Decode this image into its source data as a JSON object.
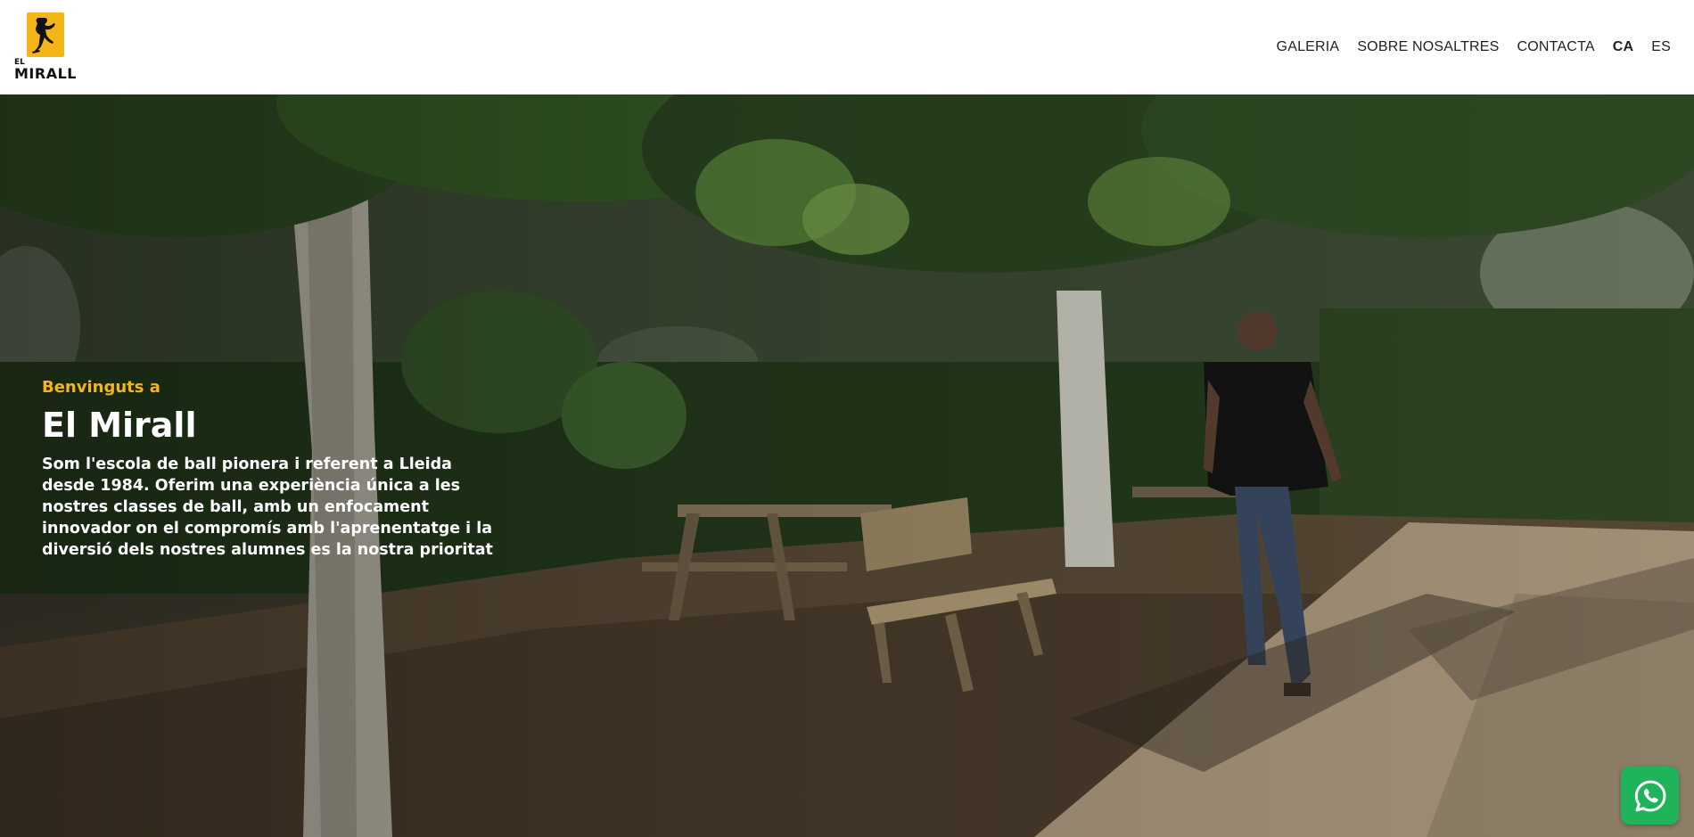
{
  "logo": {
    "line1": "EL",
    "line2": "MIRALL",
    "brand_color": "#f3b518"
  },
  "nav": {
    "items": [
      {
        "label": "GALERIA"
      },
      {
        "label": "SOBRE NOSALTRES"
      },
      {
        "label": "CONTACTA"
      },
      {
        "label": "CA",
        "active": true
      },
      {
        "label": "ES"
      }
    ]
  },
  "hero": {
    "eyebrow": "Benvinguts a",
    "title": "El Mirall",
    "description": "Som l'escola de ball pionera i referent a Lleida desde 1984. Oferim una experiència única a les nostres classes de ball, amb un enfocament innovador on el compromís amb l'aprenentatge i la diversió dels nostres alumnes es la nostra prioritat",
    "accent_color": "#f3b518"
  },
  "whatsapp": {
    "icon": "whatsapp-icon",
    "color": "#1fb35a"
  }
}
